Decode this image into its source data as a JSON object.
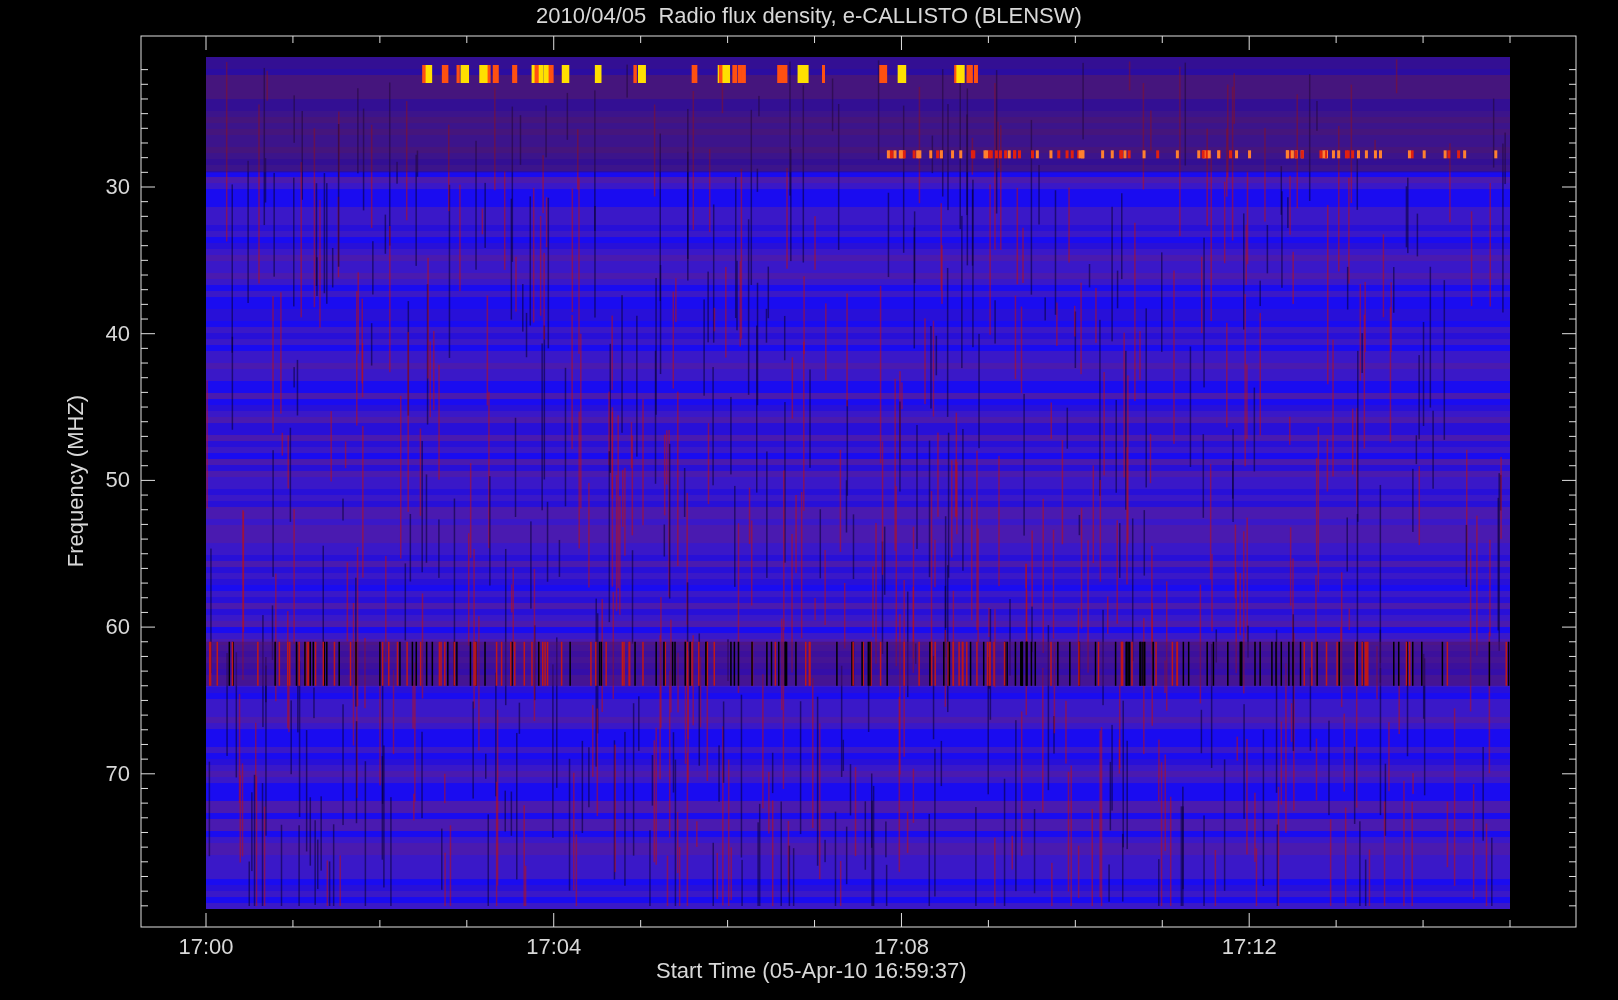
{
  "title": "2010/04/05  Radio flux density, e-CALLISTO (BLENSW)",
  "y_axis": {
    "label": "Frequency (MHZ)",
    "ticks": [
      "30",
      "40",
      "50",
      "60",
      "70"
    ]
  },
  "x_axis": {
    "label": "Start Time (05-Apr-10 16:59:37)",
    "ticks": [
      "17:00",
      "17:04",
      "17:08",
      "17:12"
    ]
  }
}
